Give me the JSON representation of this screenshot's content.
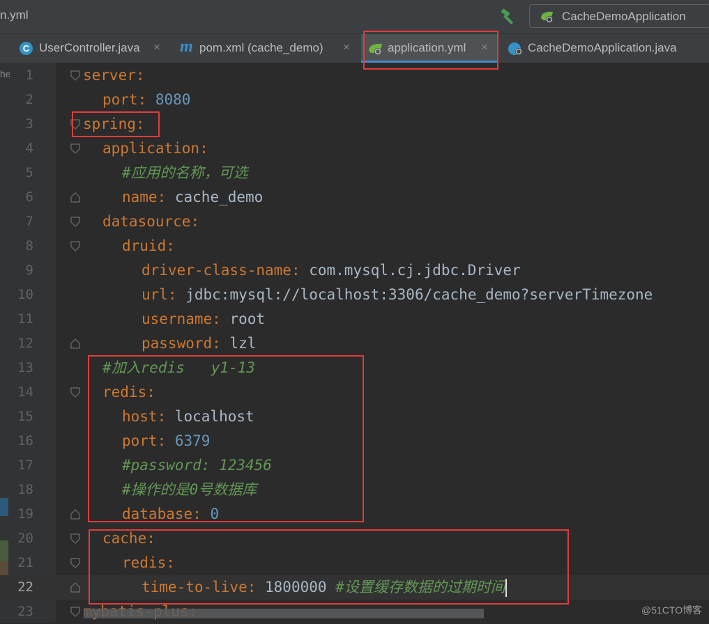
{
  "titlebar": {
    "file_crumb": "n.yml",
    "build_icon": "hammer-icon",
    "run_config": {
      "label": "CacheDemoApplication",
      "icon": "spring-boot-icon"
    }
  },
  "tabs": [
    {
      "label": "UserController.java",
      "icon": "java-class-icon",
      "close": "×"
    },
    {
      "label": "pom.xml (cache_demo)",
      "icon": "maven-icon",
      "close": "×"
    },
    {
      "label": "application.yml",
      "icon": "spring-config-icon",
      "close": "×",
      "active": true
    },
    {
      "label": "CacheDemoApplication.java",
      "icon": "spring-boot-class-icon",
      "close": "×"
    }
  ],
  "left_strip": {
    "text": "he"
  },
  "lines": [
    {
      "num": "1",
      "parts": [
        [
          "k",
          "server"
        ],
        [
          "p",
          ":"
        ]
      ]
    },
    {
      "num": "2",
      "parts": [
        [
          "k",
          "port"
        ],
        [
          "p",
          ": "
        ],
        [
          "n",
          "8080"
        ]
      ]
    },
    {
      "num": "3",
      "parts": [
        [
          "k",
          "spring"
        ],
        [
          "p",
          ":"
        ]
      ]
    },
    {
      "num": "4",
      "parts": [
        [
          "k",
          "application"
        ],
        [
          "p",
          ":"
        ]
      ]
    },
    {
      "num": "5",
      "parts": [
        [
          "c",
          "#应用的名称，可选"
        ]
      ]
    },
    {
      "num": "6",
      "parts": [
        [
          "k",
          "name"
        ],
        [
          "p",
          ": "
        ],
        [
          "s",
          "cache_demo"
        ]
      ]
    },
    {
      "num": "7",
      "parts": [
        [
          "k",
          "datasource"
        ],
        [
          "p",
          ":"
        ]
      ]
    },
    {
      "num": "8",
      "parts": [
        [
          "k",
          "druid"
        ],
        [
          "p",
          ":"
        ]
      ]
    },
    {
      "num": "9",
      "parts": [
        [
          "k",
          "driver-class-name"
        ],
        [
          "p",
          ": "
        ],
        [
          "s",
          "com.mysql.cj.jdbc.Driver"
        ]
      ]
    },
    {
      "num": "10",
      "parts": [
        [
          "k",
          "url"
        ],
        [
          "p",
          ": "
        ],
        [
          "s",
          "jdbc:mysql://localhost:3306/cache_demo?serverTimezone"
        ]
      ]
    },
    {
      "num": "11",
      "parts": [
        [
          "k",
          "username"
        ],
        [
          "p",
          ": "
        ],
        [
          "s",
          "root"
        ]
      ]
    },
    {
      "num": "12",
      "parts": [
        [
          "k",
          "password"
        ],
        [
          "p",
          ": "
        ],
        [
          "s",
          "lzl"
        ]
      ]
    },
    {
      "num": "13",
      "parts": [
        [
          "c",
          "#加入redis   y1-13"
        ]
      ]
    },
    {
      "num": "14",
      "parts": [
        [
          "k",
          "redis"
        ],
        [
          "p",
          ":"
        ]
      ]
    },
    {
      "num": "15",
      "parts": [
        [
          "k",
          "host"
        ],
        [
          "p",
          ": "
        ],
        [
          "s",
          "localhost"
        ]
      ]
    },
    {
      "num": "16",
      "parts": [
        [
          "k",
          "port"
        ],
        [
          "p",
          ": "
        ],
        [
          "n",
          "6379"
        ]
      ]
    },
    {
      "num": "17",
      "parts": [
        [
          "c",
          "#password: 123456"
        ]
      ]
    },
    {
      "num": "18",
      "parts": [
        [
          "c",
          "#操作的是0号数据库"
        ]
      ]
    },
    {
      "num": "19",
      "parts": [
        [
          "k",
          "database"
        ],
        [
          "p",
          ": "
        ],
        [
          "n",
          "0"
        ]
      ]
    },
    {
      "num": "20",
      "parts": [
        [
          "k",
          "cache"
        ],
        [
          "p",
          ":"
        ]
      ]
    },
    {
      "num": "21",
      "parts": [
        [
          "k",
          "redis"
        ],
        [
          "p",
          ":"
        ]
      ]
    },
    {
      "num": "22",
      "parts": [
        [
          "k",
          "time-to-live"
        ],
        [
          "p",
          ": "
        ],
        [
          "s",
          "1800000 "
        ],
        [
          "c",
          "#设置缓存数据的过期时间"
        ]
      ]
    },
    {
      "num": "23",
      "parts": [
        [
          "k",
          "mybatis-plus"
        ],
        [
          "p",
          ":"
        ]
      ]
    }
  ],
  "watermark": "@51CTO博客",
  "colors": {
    "keyword": "#cc7832",
    "string": "#a9b7c6",
    "number": "#6897bb",
    "comment": "#629755",
    "highlight_box": "#e03c3c",
    "active_tab_underline": "#4a88c7"
  }
}
